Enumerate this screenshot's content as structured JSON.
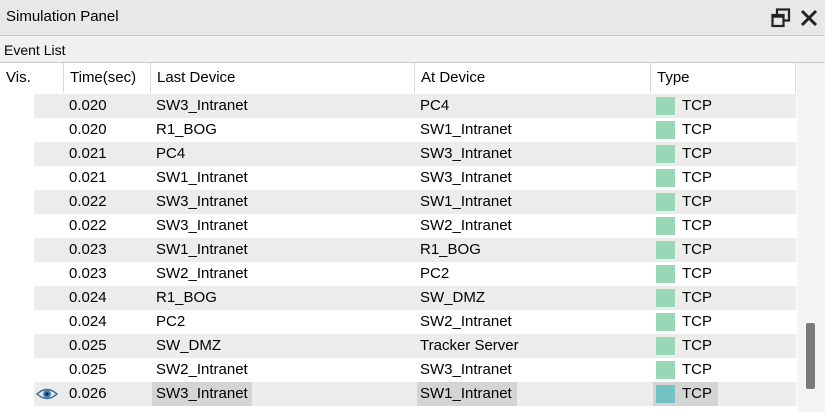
{
  "panel": {
    "title": "Simulation Panel",
    "section_label": "Event List"
  },
  "columns": {
    "vis": "Vis.",
    "time": "Time(sec)",
    "last": "Last Device",
    "at": "At Device",
    "type": "Type"
  },
  "colors": {
    "tcp_swatch": "#99d8b7",
    "tcp_swatch_selected": "#74c3c4",
    "row_shade": "#ececec",
    "selected_cell": "#d4d4d4"
  },
  "events": [
    {
      "time": "0.020",
      "last": "SW3_Intranet",
      "at": "PC4",
      "type": "TCP"
    },
    {
      "time": "0.020",
      "last": "R1_BOG",
      "at": "SW1_Intranet",
      "type": "TCP"
    },
    {
      "time": "0.021",
      "last": "PC4",
      "at": "SW3_Intranet",
      "type": "TCP"
    },
    {
      "time": "0.021",
      "last": "SW1_Intranet",
      "at": "SW3_Intranet",
      "type": "TCP"
    },
    {
      "time": "0.022",
      "last": "SW3_Intranet",
      "at": "SW1_Intranet",
      "type": "TCP"
    },
    {
      "time": "0.022",
      "last": "SW3_Intranet",
      "at": "SW2_Intranet",
      "type": "TCP"
    },
    {
      "time": "0.023",
      "last": "SW1_Intranet",
      "at": "R1_BOG",
      "type": "TCP"
    },
    {
      "time": "0.023",
      "last": "SW2_Intranet",
      "at": "PC2",
      "type": "TCP"
    },
    {
      "time": "0.024",
      "last": "R1_BOG",
      "at": "SW_DMZ",
      "type": "TCP"
    },
    {
      "time": "0.024",
      "last": "PC2",
      "at": "SW2_Intranet",
      "type": "TCP"
    },
    {
      "time": "0.025",
      "last": "SW_DMZ",
      "at": "Tracker Server",
      "type": "TCP"
    },
    {
      "time": "0.025",
      "last": "SW2_Intranet",
      "at": "SW3_Intranet",
      "type": "TCP"
    },
    {
      "time": "0.026",
      "last": "SW3_Intranet",
      "at": "SW1_Intranet",
      "type": "TCP",
      "selected": true,
      "icon": "eye-icon"
    }
  ]
}
